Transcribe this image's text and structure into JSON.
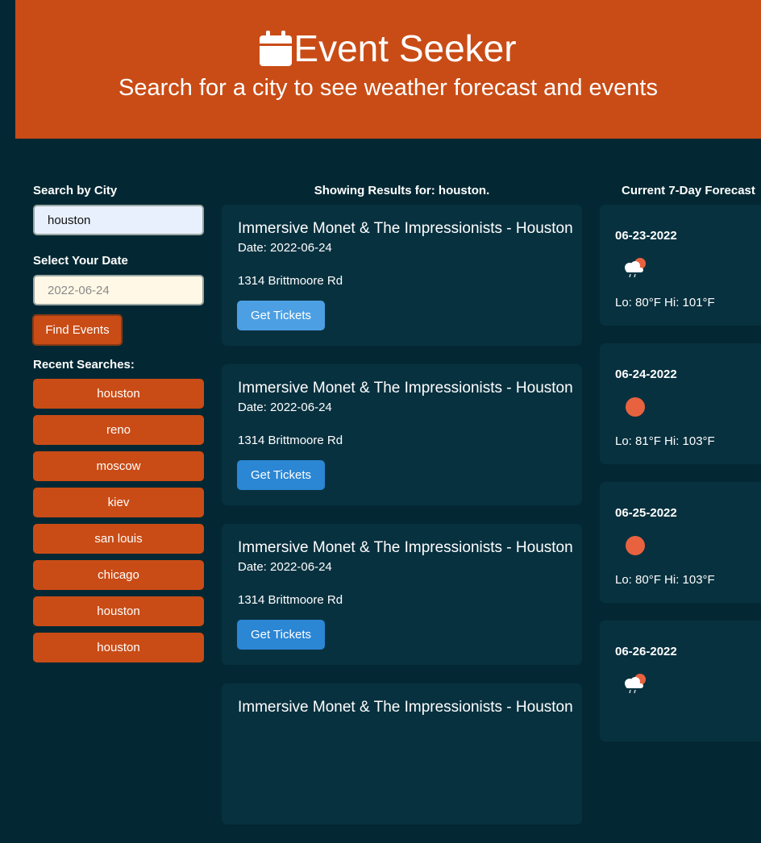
{
  "header": {
    "title": "Event Seeker",
    "subtitle": "Search for a city to see weather forecast and events",
    "icon": "calendar-icon"
  },
  "colors": {
    "header_bg": "#c94c16",
    "page_bg": "#032833",
    "card_bg": "#08313f",
    "accent_button": "#2b86d4"
  },
  "search": {
    "city_label": "Search by City",
    "city_value": "houston",
    "date_label": "Select Your Date",
    "date_placeholder": "2022-06-24",
    "find_label": "Find Events",
    "recent_label": "Recent Searches:",
    "recent": [
      "houston",
      "reno",
      "moscow",
      "kiev",
      "san louis",
      "chicago",
      "houston",
      "houston"
    ]
  },
  "results": {
    "heading": "Showing Results for: houston.",
    "events": [
      {
        "name": "Immersive Monet & The Impressionists - Houston",
        "date": "Date: 2022-06-24",
        "venue": "1314 Brittmoore Rd",
        "button": "Get Tickets"
      },
      {
        "name": "Immersive Monet & The Impressionists - Houston",
        "date": "Date: 2022-06-24",
        "venue": "1314 Brittmoore Rd",
        "button": "Get Tickets"
      },
      {
        "name": "Immersive Monet & The Impressionists - Houston",
        "date": "Date: 2022-06-24",
        "venue": "1314 Brittmoore Rd",
        "button": "Get Tickets"
      },
      {
        "name": "Immersive Monet & The Impressionists - Houston",
        "date": "",
        "venue": "",
        "button": ""
      }
    ]
  },
  "forecast": {
    "heading": "Current 7-Day Forecast",
    "days": [
      {
        "date": "06-23-2022",
        "icon": "thunderstorm-icon",
        "temps": "Lo: 80°F Hi: 101°F"
      },
      {
        "date": "06-24-2022",
        "icon": "sun-icon",
        "temps": "Lo: 81°F Hi: 103°F"
      },
      {
        "date": "06-25-2022",
        "icon": "sun-icon",
        "temps": "Lo: 80°F Hi: 103°F"
      },
      {
        "date": "06-26-2022",
        "icon": "thunderstorm-icon",
        "temps": ""
      }
    ]
  }
}
